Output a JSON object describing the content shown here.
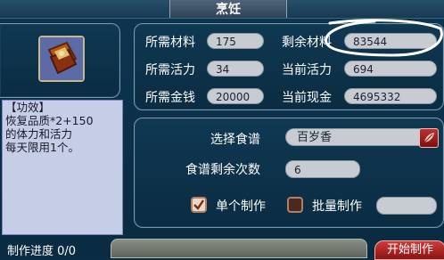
{
  "window": {
    "title": "烹饪"
  },
  "item": {
    "icon": "recipe-book-icon",
    "description_lines": [
      "【功效】",
      "恢复品质*2+150",
      "的体力和活力",
      "每天限用1个。"
    ]
  },
  "stats": {
    "required_material_label": "所需材料",
    "required_material_value": "175",
    "remaining_material_label": "剩余材料",
    "remaining_material_value": "83544",
    "required_vitality_label": "所需活力",
    "required_vitality_value": "34",
    "current_vitality_label": "当前活力",
    "current_vitality_value": "694",
    "required_money_label": "所需金钱",
    "required_money_value": "20000",
    "current_cash_label": "当前现金",
    "current_cash_value": "4695332"
  },
  "recipe": {
    "select_label": "选择食谱",
    "selected_value": "百岁香",
    "remaining_uses_label": "食谱剩余次数",
    "remaining_uses_value": "6",
    "single_label": "单个制作",
    "single_checked": true,
    "batch_label": "批量制作",
    "batch_checked": false,
    "batch_value": ""
  },
  "footer": {
    "progress_label": "制作进度 0/0",
    "progress_fraction": 0,
    "start_button": "开始制作"
  },
  "colors": {
    "background": "#0b2d44",
    "accent_red": "#c03030",
    "pill": "#c8ccd2",
    "description_bg": "#c6cde6"
  }
}
